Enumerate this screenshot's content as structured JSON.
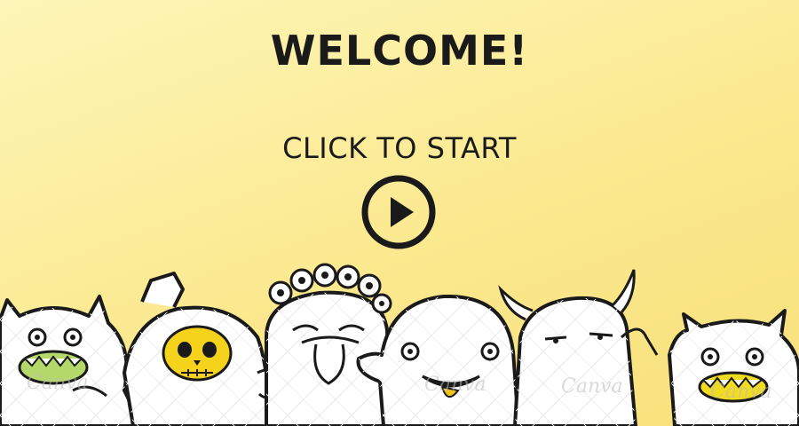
{
  "screen": {
    "title": "WELCOME!",
    "start_label": "CLICK TO START",
    "play_button_icon": "play-icon"
  },
  "watermark": {
    "text": "Canva"
  },
  "colors": {
    "background_top": "#fdf6b8",
    "background_bottom": "#f8e07a",
    "ink": "#1a1a1a",
    "monster_body": "#ffffff",
    "skull_yellow": "#f5d21c",
    "mouth_green": "#b5d86b",
    "mouth_yellow": "#f2dc1f",
    "tongue_orange": "#f2c21a"
  }
}
